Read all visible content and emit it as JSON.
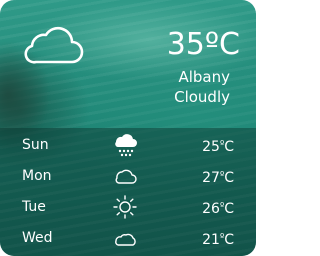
{
  "current": {
    "temperature": "35",
    "unit": "ºC",
    "city": "Albany",
    "condition": "Cloudly",
    "icon": "cloud-icon"
  },
  "forecast": [
    {
      "day": "Sun",
      "icon": "snow-cloud-icon",
      "temp": "25",
      "unit_deg": "º",
      "unit_c": "C"
    },
    {
      "day": "Mon",
      "icon": "cloud-icon",
      "temp": "27",
      "unit_deg": "º",
      "unit_c": "C"
    },
    {
      "day": "Tue",
      "icon": "sun-icon",
      "temp": "26",
      "unit_deg": "º",
      "unit_c": "C"
    },
    {
      "day": "Wed",
      "icon": "cloud-icon",
      "temp": "21",
      "unit_deg": "º",
      "unit_c": "C"
    }
  ],
  "colors": {
    "water": "#1f8676",
    "panel": "#08322d",
    "text": "#ffffff"
  }
}
